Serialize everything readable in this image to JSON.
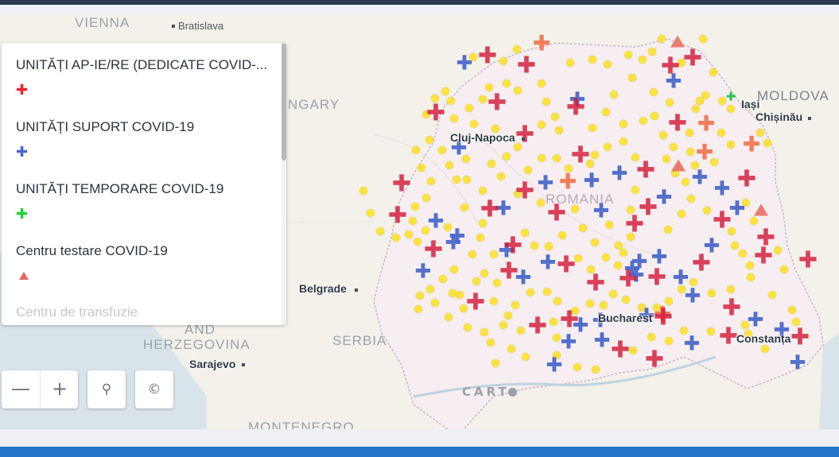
{
  "legend": {
    "items": [
      {
        "label": "UNITĂȚI AP-IE/RE (DEDICATE COVID-...",
        "icon": "red-cross-icon",
        "color": "#e8232f",
        "glyph": "✚"
      },
      {
        "label": "UNITĂȚI SUPORT COVID-19",
        "icon": "blue-cross-icon",
        "color": "#4766c9",
        "glyph": "✚"
      },
      {
        "label": "UNITĂȚI TEMPORARE COVID-19",
        "icon": "green-cross-icon",
        "color": "#23d13a",
        "glyph": "✚"
      },
      {
        "label": "Centru testare COVID-19",
        "icon": "flask-icon",
        "color": "#e8685a"
      },
      {
        "label": "Centru de transfuzie"
      }
    ]
  },
  "map": {
    "country_labels": {
      "vienna": "VIENNA",
      "hungary": "NGARY",
      "romania": "ROMANIA",
      "moldova": "MOLDOVA",
      "and": "AND",
      "herzegovina": "HERZEGOVINA",
      "serbia": "SERBIA",
      "montenegro": "MONTENEGRO"
    },
    "city_labels": {
      "bratislava": "Bratislava",
      "cluj": "Cluj-Napoca",
      "iasi": "Iași",
      "chisinau": "Chișinău",
      "belgrade": "Belgrade",
      "bucharest": "Bucharest",
      "constanta": "Constanța",
      "sarajevo": "Sarajevo"
    },
    "attribution": "CART"
  },
  "controls": {
    "zoom_out": "—",
    "zoom_in": "+",
    "search": "⚲",
    "copyright": "©"
  }
}
